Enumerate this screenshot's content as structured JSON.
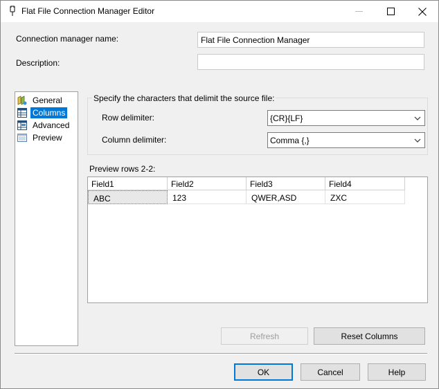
{
  "window": {
    "title": "Flat File Connection Manager Editor"
  },
  "form": {
    "name_label": "Connection manager name:",
    "name_value": "Flat File Connection Manager",
    "description_label": "Description:",
    "description_value": ""
  },
  "nav": {
    "items": [
      {
        "label": "General",
        "icon": "general-icon"
      },
      {
        "label": "Columns",
        "icon": "columns-icon",
        "selected": true
      },
      {
        "label": "Advanced",
        "icon": "advanced-icon"
      },
      {
        "label": "Preview",
        "icon": "preview-icon"
      }
    ]
  },
  "delimiters": {
    "group_title": "Specify the characters that delimit the source file:",
    "row_label": "Row delimiter:",
    "row_value": "{CR}{LF}",
    "column_label": "Column delimiter:",
    "column_value": "Comma {,}"
  },
  "preview": {
    "label": "Preview rows 2-2:",
    "columns": [
      "Field1",
      "Field2",
      "Field3",
      "Field4"
    ],
    "rows": [
      [
        "ABC",
        "123",
        "QWER,ASD",
        "ZXC"
      ]
    ]
  },
  "buttons": {
    "refresh": "Refresh",
    "reset_columns": "Reset Columns",
    "ok": "OK",
    "cancel": "Cancel",
    "help": "Help"
  },
  "colors": {
    "selection": "#0078d7",
    "dialog_bg": "#f0f0f0"
  }
}
